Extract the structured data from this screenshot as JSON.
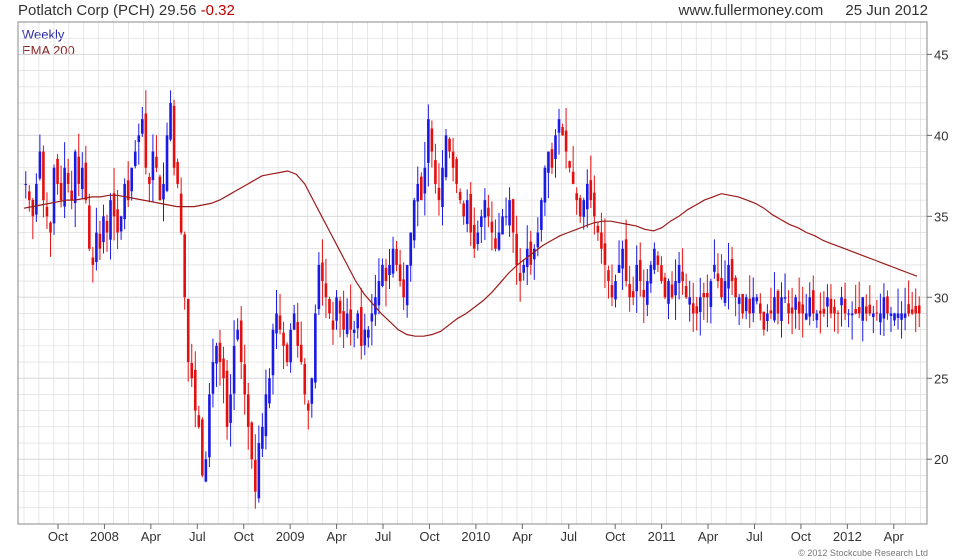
{
  "header": {
    "company": "Potlatch Corp (PCH)",
    "price": "29.56",
    "change": "-0.32",
    "source": "www.fullermoney.com",
    "date": "25 Jun 2012"
  },
  "legend": {
    "weekly": "Weekly",
    "ema": "EMA 200"
  },
  "copyright": "© 2012 Stockcube Research Ltd",
  "colors": {
    "up": "#1a1ae6",
    "down": "#e60f0f",
    "ema": "#9b1b1b",
    "grid": "#d8d8d8"
  },
  "chart_data": {
    "type": "candlestick",
    "ylim": [
      16,
      47
    ],
    "yticks": [
      20,
      25,
      30,
      35,
      40,
      45
    ],
    "xticks": [
      {
        "label": "Oct",
        "w": 6
      },
      {
        "label": "2008",
        "w": 19
      },
      {
        "label": "Apr",
        "w": 32
      },
      {
        "label": "Jul",
        "w": 45
      },
      {
        "label": "Oct",
        "w": 58
      },
      {
        "label": "2009",
        "w": 71
      },
      {
        "label": "Apr",
        "w": 84
      },
      {
        "label": "Jul",
        "w": 97
      },
      {
        "label": "Oct",
        "w": 110
      },
      {
        "label": "2010",
        "w": 123
      },
      {
        "label": "Apr",
        "w": 136
      },
      {
        "label": "Jul",
        "w": 149
      },
      {
        "label": "Oct",
        "w": 162
      },
      {
        "label": "2011",
        "w": 175
      },
      {
        "label": "Apr",
        "w": 188
      },
      {
        "label": "Jul",
        "w": 201
      },
      {
        "label": "Oct",
        "w": 214
      },
      {
        "label": "2012",
        "w": 227
      },
      {
        "label": "Apr",
        "w": 240
      }
    ],
    "weeks_total": 260,
    "closes": [
      37,
      36,
      35,
      37,
      39,
      36,
      35,
      34,
      38,
      37,
      36,
      38,
      37,
      36,
      39,
      37,
      38,
      36,
      33,
      32,
      34,
      33,
      35,
      34,
      36,
      35,
      34,
      35,
      37,
      36,
      38,
      39,
      40,
      41,
      38,
      37,
      39,
      38,
      36,
      37,
      40,
      42,
      38,
      37,
      34,
      30,
      26,
      25,
      23,
      22,
      19,
      20,
      24,
      26,
      27,
      26,
      25,
      22,
      24,
      27,
      28,
      26,
      24,
      22,
      20,
      18,
      21,
      22,
      24,
      25,
      28,
      29,
      28,
      27,
      26,
      28,
      29,
      27,
      26,
      24,
      23,
      25,
      29,
      32,
      31,
      30,
      29,
      28,
      30,
      29,
      28,
      29,
      28,
      28,
      29,
      27,
      28,
      28,
      29,
      30,
      31,
      32,
      31,
      32,
      33,
      32,
      31,
      30,
      32,
      34,
      36,
      37,
      36,
      38,
      41,
      39,
      37,
      36,
      38,
      40,
      39,
      38,
      37,
      36,
      35,
      36,
      34,
      33,
      34,
      35,
      36,
      35,
      34,
      33,
      34,
      35,
      35,
      36,
      34,
      32,
      31,
      32,
      33,
      32,
      33,
      34,
      36,
      38,
      39,
      38,
      40,
      41,
      40,
      39,
      38,
      37,
      36,
      35,
      36,
      37,
      36,
      35,
      34,
      33,
      32,
      31,
      30,
      31,
      32,
      33,
      31,
      30,
      30,
      32,
      31,
      30,
      31,
      32,
      33,
      32,
      31,
      30,
      31,
      30,
      31,
      32,
      31,
      30,
      30,
      29,
      29,
      30,
      30,
      30,
      31,
      32,
      31,
      30,
      31,
      32,
      31,
      30,
      30,
      29,
      30,
      29,
      30,
      30,
      29,
      28,
      29,
      29,
      30,
      29,
      30,
      30,
      29,
      29,
      30,
      29,
      29,
      29,
      30,
      29,
      29,
      29,
      29,
      30,
      29,
      29,
      29,
      30,
      29,
      29,
      29,
      29,
      29,
      30,
      29,
      29,
      29,
      29,
      29,
      30,
      29,
      29,
      29,
      29,
      29,
      29,
      29,
      29,
      29,
      29
    ],
    "ema200": [
      35.5,
      35.6,
      35.7,
      35.8,
      35.9,
      36.0,
      36.0,
      36.1,
      36.2,
      36.2,
      36.3,
      36.3,
      36.2,
      36.1,
      36.0,
      35.9,
      35.8,
      35.7,
      35.6,
      35.6,
      35.6,
      35.7,
      35.8,
      36.0,
      36.3,
      36.6,
      36.9,
      37.2,
      37.5,
      37.6,
      37.7,
      37.8,
      37.6,
      37.0,
      36.0,
      35.0,
      34.0,
      33.0,
      32.0,
      31.0,
      30.2,
      29.6,
      29.0,
      28.5,
      28.0,
      27.7,
      27.6,
      27.6,
      27.7,
      27.9,
      28.3,
      28.7,
      29.0,
      29.4,
      29.8,
      30.3,
      30.9,
      31.5,
      32.0,
      32.4,
      32.8,
      33.2,
      33.5,
      33.8,
      34.0,
      34.2,
      34.4,
      34.6,
      34.7,
      34.7,
      34.6,
      34.5,
      34.4,
      34.2,
      34.1,
      34.3,
      34.7,
      35.0,
      35.4,
      35.7,
      36.0,
      36.2,
      36.4,
      36.3,
      36.2,
      36.0,
      35.8,
      35.5,
      35.1,
      34.8,
      34.5,
      34.3,
      34.0,
      33.8,
      33.5,
      33.3,
      33.1,
      32.9,
      32.7,
      32.5,
      32.3,
      32.1,
      31.9,
      31.7,
      31.5,
      31.3
    ]
  }
}
